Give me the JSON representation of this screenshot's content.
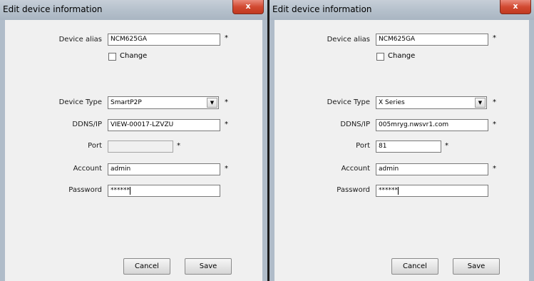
{
  "dialogs": [
    {
      "title": "Edit device information",
      "close_label": "x",
      "fields": {
        "alias_label": "Device alias",
        "alias_value": "NCM625GA",
        "change_label": "Change",
        "type_label": "Device Type",
        "type_value": "SmartP2P",
        "ddns_label": "DDNS/IP",
        "ddns_value": "VIEW-00017-LZVZU",
        "port_label": "Port",
        "port_value": "",
        "account_label": "Account",
        "account_value": "admin",
        "password_label": "Password",
        "password_value": "******"
      },
      "required_mark": "*",
      "cancel_label": "Cancel",
      "save_label": "Save"
    },
    {
      "title": "Edit device information",
      "close_label": "x",
      "fields": {
        "alias_label": "Device alias",
        "alias_value": "NCM625GA",
        "change_label": "Change",
        "type_label": "Device Type",
        "type_value": "X Series",
        "ddns_label": "DDNS/IP",
        "ddns_value": "005mryg.nwsvr1.com",
        "port_label": "Port",
        "port_value": "81",
        "account_label": "Account",
        "account_value": "admin",
        "password_label": "Password",
        "password_value": "******"
      },
      "required_mark": "*",
      "cancel_label": "Cancel",
      "save_label": "Save"
    }
  ],
  "colors": {
    "titlebar": "#b7c2cd",
    "close_button": "#d24a32",
    "client_bg": "#f0f0f0"
  }
}
